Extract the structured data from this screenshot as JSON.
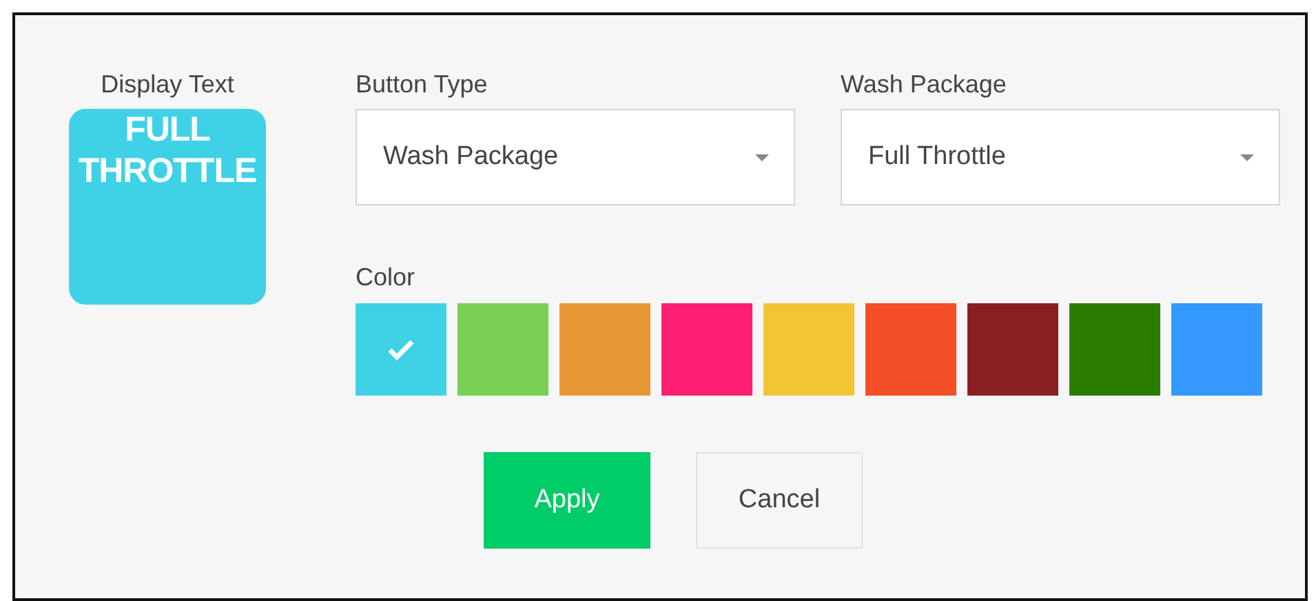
{
  "display_text": {
    "label": "Display Text",
    "text": "FULL THROTTLE"
  },
  "button_type": {
    "label": "Button Type",
    "value": "Wash Package"
  },
  "wash_package": {
    "label": "Wash Package",
    "value": "Full Throttle"
  },
  "color": {
    "label": "Color",
    "swatches": [
      {
        "color": "#3fd2e7",
        "selected": true
      },
      {
        "color": "#7acf55",
        "selected": false
      },
      {
        "color": "#e89735",
        "selected": false
      },
      {
        "color": "#ff1f72",
        "selected": false
      },
      {
        "color": "#f2c533",
        "selected": false
      },
      {
        "color": "#f44e27",
        "selected": false
      },
      {
        "color": "#8b2022",
        "selected": false
      },
      {
        "color": "#2b7d00",
        "selected": false
      },
      {
        "color": "#3399ff",
        "selected": false
      }
    ]
  },
  "buttons": [
    {
      "label": "Apply",
      "kind": "primary"
    },
    {
      "label": "Cancel",
      "kind": "secondary"
    }
  ]
}
